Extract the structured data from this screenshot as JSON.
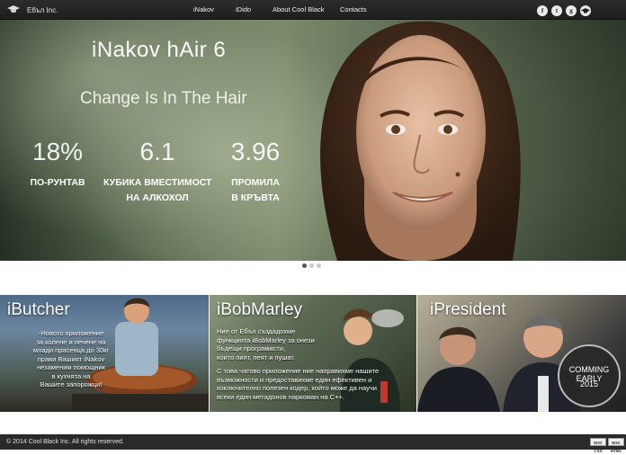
{
  "brand": {
    "name": "Ебъл Inc."
  },
  "nav": {
    "items": [
      "iNakov",
      "iDido",
      "About Cool Black",
      "Contacts"
    ]
  },
  "social": {
    "facebook": "f",
    "twitter": "t",
    "google": "g",
    "graduation": "cap"
  },
  "hero": {
    "title": "iNakov hAir 6",
    "subtitle": "Change Is In The Hair",
    "stats": [
      {
        "value": "18%",
        "label_line1": "ПО-РУНТАВ",
        "label_line2": ""
      },
      {
        "value": "6.1",
        "label_line1": "КУБИКА ВМЕСТИМОСТ",
        "label_line2": "НА АЛКОХОЛ"
      },
      {
        "value": "3.96",
        "label_line1": "ПРОМИЛА",
        "label_line2": "В КРЪВТА"
      }
    ]
  },
  "carousel": {
    "slides": 3,
    "active_index": 0
  },
  "cards": [
    {
      "title": "iButcher",
      "text_lines": [
        "-Новото приложение",
        "за колене и печене на",
        "млади прасенца до 30кг",
        "прави Вашият iNakov",
        "незаменим помощник",
        "в кухнята на",
        "Вашите запорожци!"
      ]
    },
    {
      "title": "iBobMarley",
      "text_lines": [
        "Ние от Ебъл създадохме",
        "функцията iBobMarley за онези",
        "бъдещи програмисти,",
        "които пият, пеят и пушат.",
        "",
        "С това чатово приложение ние направихме нашите",
        "възможности и предоставихме един ефективен и",
        "изключително полезен кодер, който може да научи",
        "всеки един метадонов наркоман на С++."
      ]
    },
    {
      "title": "iPresident",
      "badge_line1": "COMMING EARLY",
      "badge_line2": "2015"
    }
  ],
  "footer": {
    "copyright": "© 2014 Cool Black Inc. All rights reserved.",
    "badges": [
      "W3C CSS",
      "W3C HTML"
    ]
  }
}
